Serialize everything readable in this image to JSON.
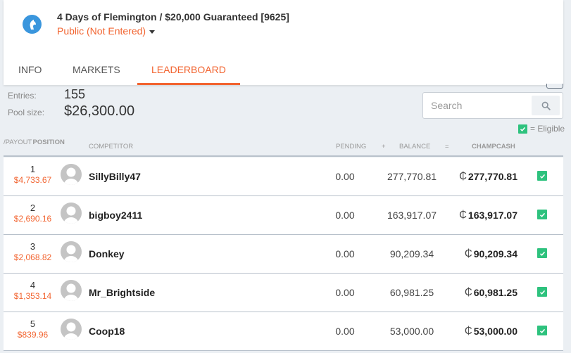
{
  "event": {
    "title": "4 Days of Flemington / $20,000 Guaranteed [9625]",
    "status": "Public (Not Entered)",
    "icon": "horse-head-icon"
  },
  "tabs": [
    {
      "label": "INFO",
      "active": false
    },
    {
      "label": "MARKETS",
      "active": false
    },
    {
      "label": "LEADERBOARD",
      "active": true
    }
  ],
  "stats": {
    "entries_label": "Entries:",
    "entries_value": "155",
    "pool_label": "Pool size:",
    "pool_value": "$26,300.00"
  },
  "search": {
    "placeholder": "Search",
    "value": ""
  },
  "legend": {
    "eligible_label": "= Eligible"
  },
  "columns": {
    "position": "POSITION",
    "payout": "/PAYOUT",
    "competitor": "COMPETITOR",
    "pending": "PENDING",
    "plus": "+",
    "balance": "BALANCE",
    "equals": "=",
    "champcash": "CHAMPCASH"
  },
  "currency_symbol": "₵",
  "colors": {
    "accent": "#f26430",
    "eligible": "#2ec27e",
    "event_icon": "#3a96dd"
  },
  "rows": [
    {
      "position": "1",
      "payout": "$4,733.67",
      "competitor": "SillyBilly47",
      "pending": "0.00",
      "balance": "277,770.81",
      "champcash": "277,770.81",
      "eligible": true
    },
    {
      "position": "2",
      "payout": "$2,690.16",
      "competitor": "bigboy2411",
      "pending": "0.00",
      "balance": "163,917.07",
      "champcash": "163,917.07",
      "eligible": true
    },
    {
      "position": "3",
      "payout": "$2,068.82",
      "competitor": "Donkey",
      "pending": "0.00",
      "balance": "90,209.34",
      "champcash": "90,209.34",
      "eligible": true
    },
    {
      "position": "4",
      "payout": "$1,353.14",
      "competitor": "Mr_Brightside",
      "pending": "0.00",
      "balance": "60,981.25",
      "champcash": "60,981.25",
      "eligible": true
    },
    {
      "position": "5",
      "payout": "$839.96",
      "competitor": "Coop18",
      "pending": "0.00",
      "balance": "53,000.00",
      "champcash": "53,000.00",
      "eligible": true
    }
  ]
}
